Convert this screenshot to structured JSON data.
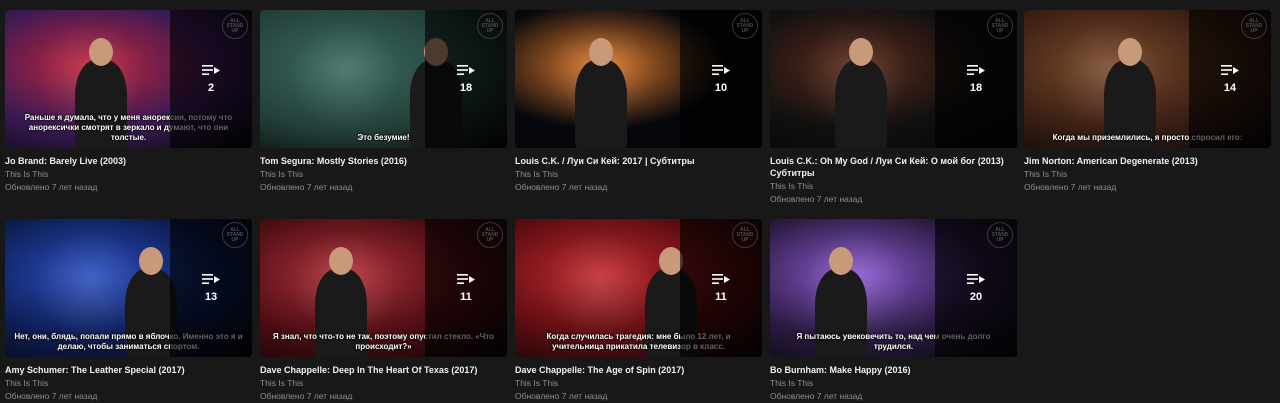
{
  "playlists": [
    {
      "title": "Jo Brand: Barely Live (2003)",
      "channel": "This Is This",
      "updated": "Обновлено 7 лет назад",
      "count": "2",
      "subtitle": "Раньше я думала, что у меня анорексия, потому что анорексички смотрят в зеркало и думают, что они толстые.",
      "logo": "ALL STAND UP",
      "theme": {
        "bg": "#3a1a55",
        "accent": "#c0243a"
      }
    },
    {
      "title": "Tom Segura: Mostly Stories (2016)",
      "channel": "This Is This",
      "updated": "Обновлено 7 лет назад",
      "count": "18",
      "subtitle": "Это безумие!",
      "logo": "ALL STAND UP",
      "theme": {
        "bg": "#24403a",
        "accent": "#3b6b5e"
      }
    },
    {
      "title": "Louis C.K. / Луи Си Кей: 2017 | Субтитры",
      "channel": "This Is This",
      "updated": "Обновлено 7 лет назад",
      "count": "10",
      "subtitle": "",
      "logo": "ALL STAND UP",
      "theme": {
        "bg": "#05070d",
        "accent": "#e07a2a"
      }
    },
    {
      "title": "Louis C.K.: Oh My God / Луи Си Кей: О мой бог (2013) Субтитры",
      "channel": "This Is This",
      "updated": "Обновлено 7 лет назад",
      "count": "18",
      "subtitle": "",
      "logo": "ALL STAND UP",
      "theme": {
        "bg": "#101010",
        "accent": "#5a2a1a"
      }
    },
    {
      "title": "Jim Norton: American Degenerate (2013)",
      "channel": "This Is This",
      "updated": "Обновлено 7 лет назад",
      "count": "14",
      "subtitle": "Когда мы приземлились, я просто спросил его:",
      "logo": "ALL STAND UP",
      "theme": {
        "bg": "#3a1f14",
        "accent": "#7a4a2a"
      }
    },
    {
      "title": "Amy Schumer: The Leather Special (2017)",
      "channel": "This Is This",
      "updated": "Обновлено 7 лет назад",
      "count": "13",
      "subtitle": "Нет, они, блядь, попали прямо в яблочко. Именно это я и делаю, чтобы заниматься спортом.",
      "logo": "ALL STAND UP",
      "theme": {
        "bg": "#0d1d52",
        "accent": "#2a4ec0"
      }
    },
    {
      "title": "Dave Chappelle: Deep In The Heart Of Texas (2017)",
      "channel": "This Is This",
      "updated": "Обновлено 7 лет назад",
      "count": "11",
      "subtitle": "Я знал, что что-то не так, поэтому опустил стекло. «Что происходит?»",
      "logo": "ALL STAND UP",
      "theme": {
        "bg": "#4a0d12",
        "accent": "#b0303a"
      }
    },
    {
      "title": "Dave Chappelle: The Age of Spin (2017)",
      "channel": "This Is This",
      "updated": "Обновлено 7 лет назад",
      "count": "11",
      "subtitle": "Когда случилась трагедия: мне было 12 лет, и учительница прикатила телевизор в класс.",
      "logo": "ALL STAND UP",
      "theme": {
        "bg": "#5a0c10",
        "accent": "#c02a30"
      }
    },
    {
      "title": "Bo Burnham: Make Happy (2016)",
      "channel": "This Is This",
      "updated": "Обновлено 7 лет назад",
      "count": "20",
      "subtitle": "Я пытаюсь увековечить то, над чем очень долго трудился.",
      "logo": "ALL STAND UP",
      "theme": {
        "bg": "#2a1a40",
        "accent": "#8a5ad0"
      }
    }
  ]
}
